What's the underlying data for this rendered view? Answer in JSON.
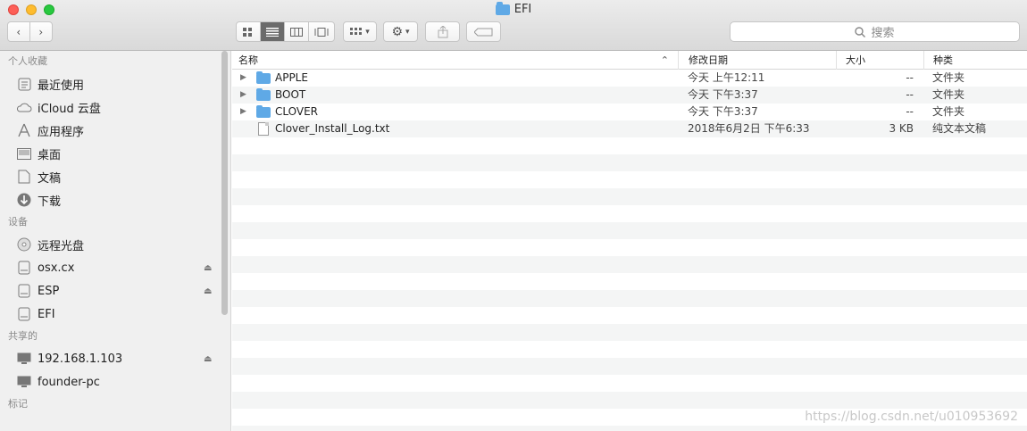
{
  "window": {
    "title": "EFI"
  },
  "toolbar": {
    "search_placeholder": "搜索"
  },
  "sidebar": {
    "sections": [
      {
        "title": "个人收藏",
        "items": [
          {
            "label": "最近使用",
            "icon": "recents-icon"
          },
          {
            "label": "iCloud 云盘",
            "icon": "cloud-icon"
          },
          {
            "label": "应用程序",
            "icon": "applications-icon"
          },
          {
            "label": "桌面",
            "icon": "desktop-icon"
          },
          {
            "label": "文稿",
            "icon": "documents-icon"
          },
          {
            "label": "下载",
            "icon": "download-icon"
          }
        ]
      },
      {
        "title": "设备",
        "items": [
          {
            "label": "远程光盘",
            "icon": "disc-icon"
          },
          {
            "label": "osx.cx",
            "icon": "drive-icon",
            "eject": true
          },
          {
            "label": "ESP",
            "icon": "drive-icon",
            "eject": true
          },
          {
            "label": "EFI",
            "icon": "drive-icon"
          }
        ]
      },
      {
        "title": "共享的",
        "items": [
          {
            "label": "192.168.1.103",
            "icon": "computer-icon",
            "eject": true
          },
          {
            "label": "founder-pc",
            "icon": "computer-icon"
          }
        ]
      },
      {
        "title": "标记",
        "items": []
      }
    ]
  },
  "columns": {
    "name": "名称",
    "date": "修改日期",
    "size": "大小",
    "kind": "种类"
  },
  "files": [
    {
      "name": "APPLE",
      "date": "今天 上午12:11",
      "size": "--",
      "kind": "文件夹",
      "type": "folder"
    },
    {
      "name": "BOOT",
      "date": "今天 下午3:37",
      "size": "--",
      "kind": "文件夹",
      "type": "folder"
    },
    {
      "name": "CLOVER",
      "date": "今天 下午3:37",
      "size": "--",
      "kind": "文件夹",
      "type": "folder"
    },
    {
      "name": "Clover_Install_Log.txt",
      "date": "2018年6月2日 下午6:33",
      "size": "3 KB",
      "kind": "纯文本文稿",
      "type": "file"
    }
  ],
  "watermark": "https://blog.csdn.net/u010953692"
}
